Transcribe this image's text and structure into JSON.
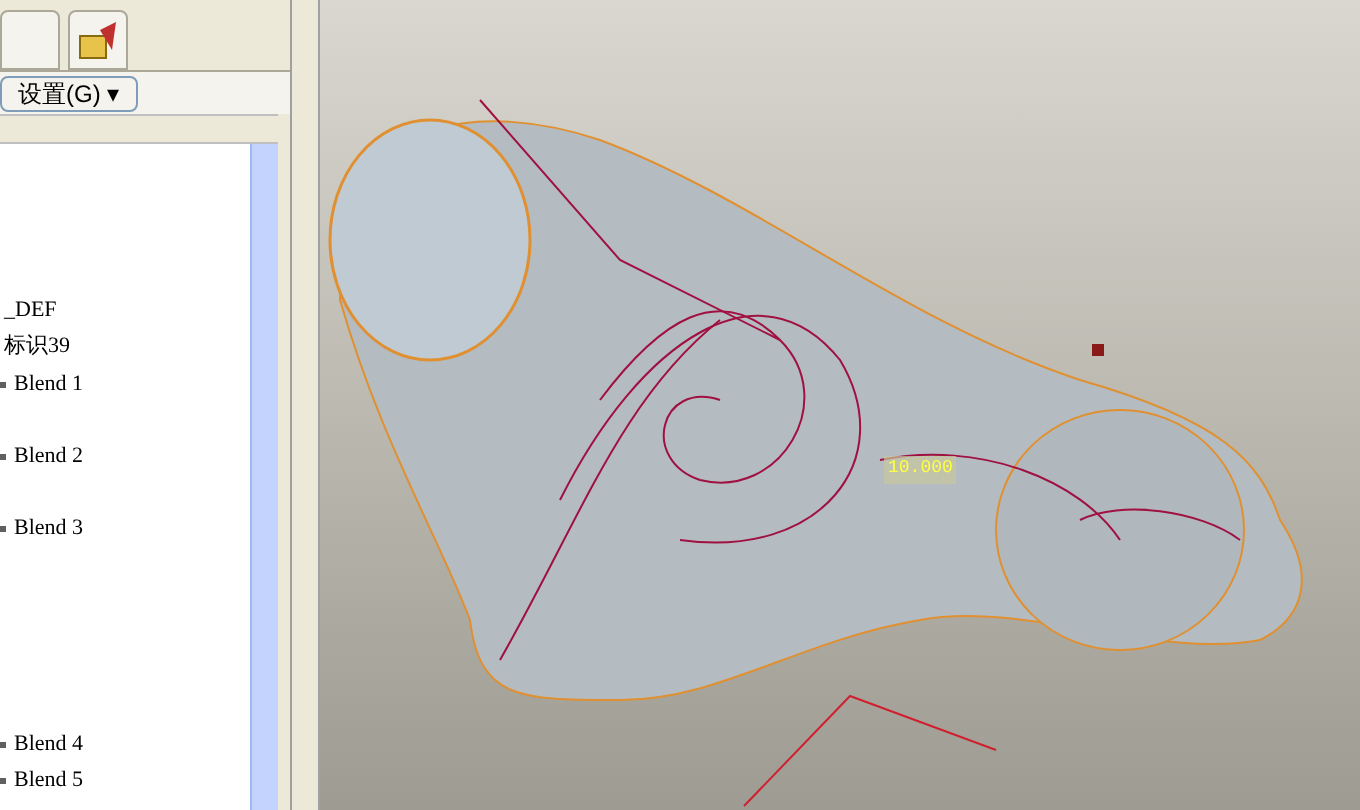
{
  "toolbar": {
    "settings_button": "设置(G) ▾"
  },
  "tree": {
    "items": [
      {
        "label": "_DEF",
        "kind": "plain"
      },
      {
        "label": "标识39",
        "kind": "plain"
      },
      {
        "label": "Blend 1",
        "kind": "feature"
      },
      {
        "label": "Blend 2",
        "kind": "feature"
      },
      {
        "label": "Blend 3",
        "kind": "feature"
      },
      {
        "label": "Blend 4",
        "kind": "feature"
      },
      {
        "label": "Blend 5",
        "kind": "feature"
      }
    ]
  },
  "viewport": {
    "dimension": "10.000"
  }
}
